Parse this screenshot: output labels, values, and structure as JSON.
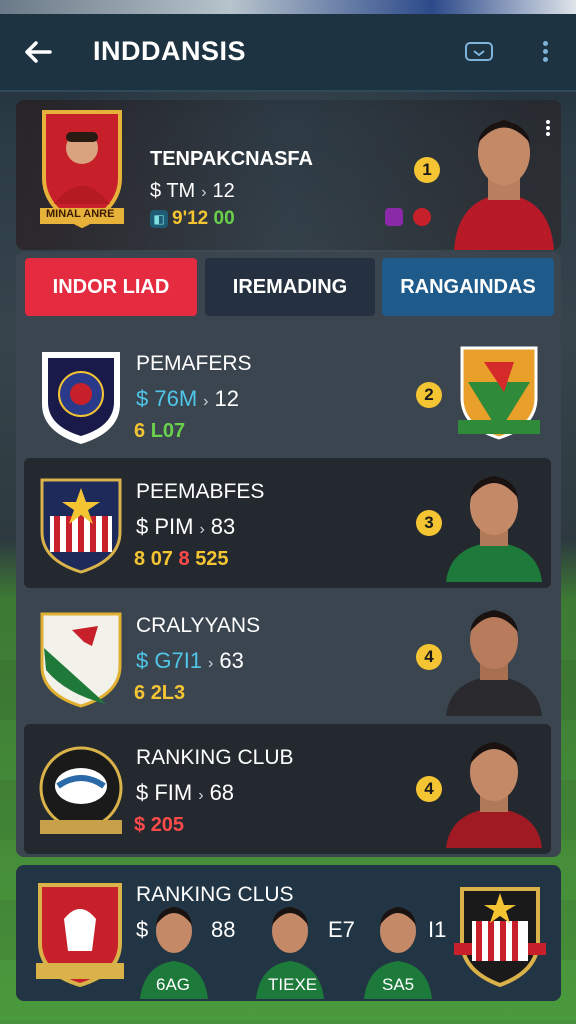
{
  "header": {
    "title": "INDDANSIS",
    "back_icon": "arrow-left-icon",
    "action_icon": "message-icon",
    "menu_icon": "more-vertical-icon"
  },
  "featured": {
    "name": "TENPAKCNASFA",
    "value": "$ TM",
    "value_target": "12",
    "stat_a": "9'12",
    "stat_b": "00",
    "rank": "1",
    "crest_caption": "MINAL ANRE"
  },
  "tabs": [
    {
      "label": "INDOR LIAD",
      "active": true
    },
    {
      "label": "IREMADING",
      "active": false
    },
    {
      "label": "RANGAINDAS",
      "active": false
    }
  ],
  "rows": [
    {
      "name": "PEMAFERS",
      "value": "$ 76M",
      "target": "12",
      "stat_icon": "6",
      "stat": "L07",
      "rank": "2"
    },
    {
      "name": "PEEMABFES",
      "value": "$ PIM",
      "target": "83",
      "stat_icon": "8",
      "stat": "07",
      "stat2_icon": "8",
      "stat2": "525",
      "rank": "3"
    },
    {
      "name": "CRALYYANS",
      "value": "$ G7I1",
      "target": "63",
      "stat_icon": "6",
      "stat": "2L3",
      "rank": "4"
    },
    {
      "name": "RANKING CLUB",
      "value": "$ FIM",
      "target": "68",
      "stat_icon": "$",
      "stat": "205",
      "rank": "4"
    }
  ],
  "bottom": {
    "name": "RANKING CLUS",
    "dollar": "$",
    "nums": [
      "88",
      "E7",
      "I1"
    ],
    "players": [
      "6AG",
      "TIEXE",
      "SA5"
    ]
  },
  "colors": {
    "accent_red": "#e42b3f",
    "rank_gold": "#f4c433",
    "tab_blue": "#1e5a8a",
    "header": "#1d3342"
  }
}
